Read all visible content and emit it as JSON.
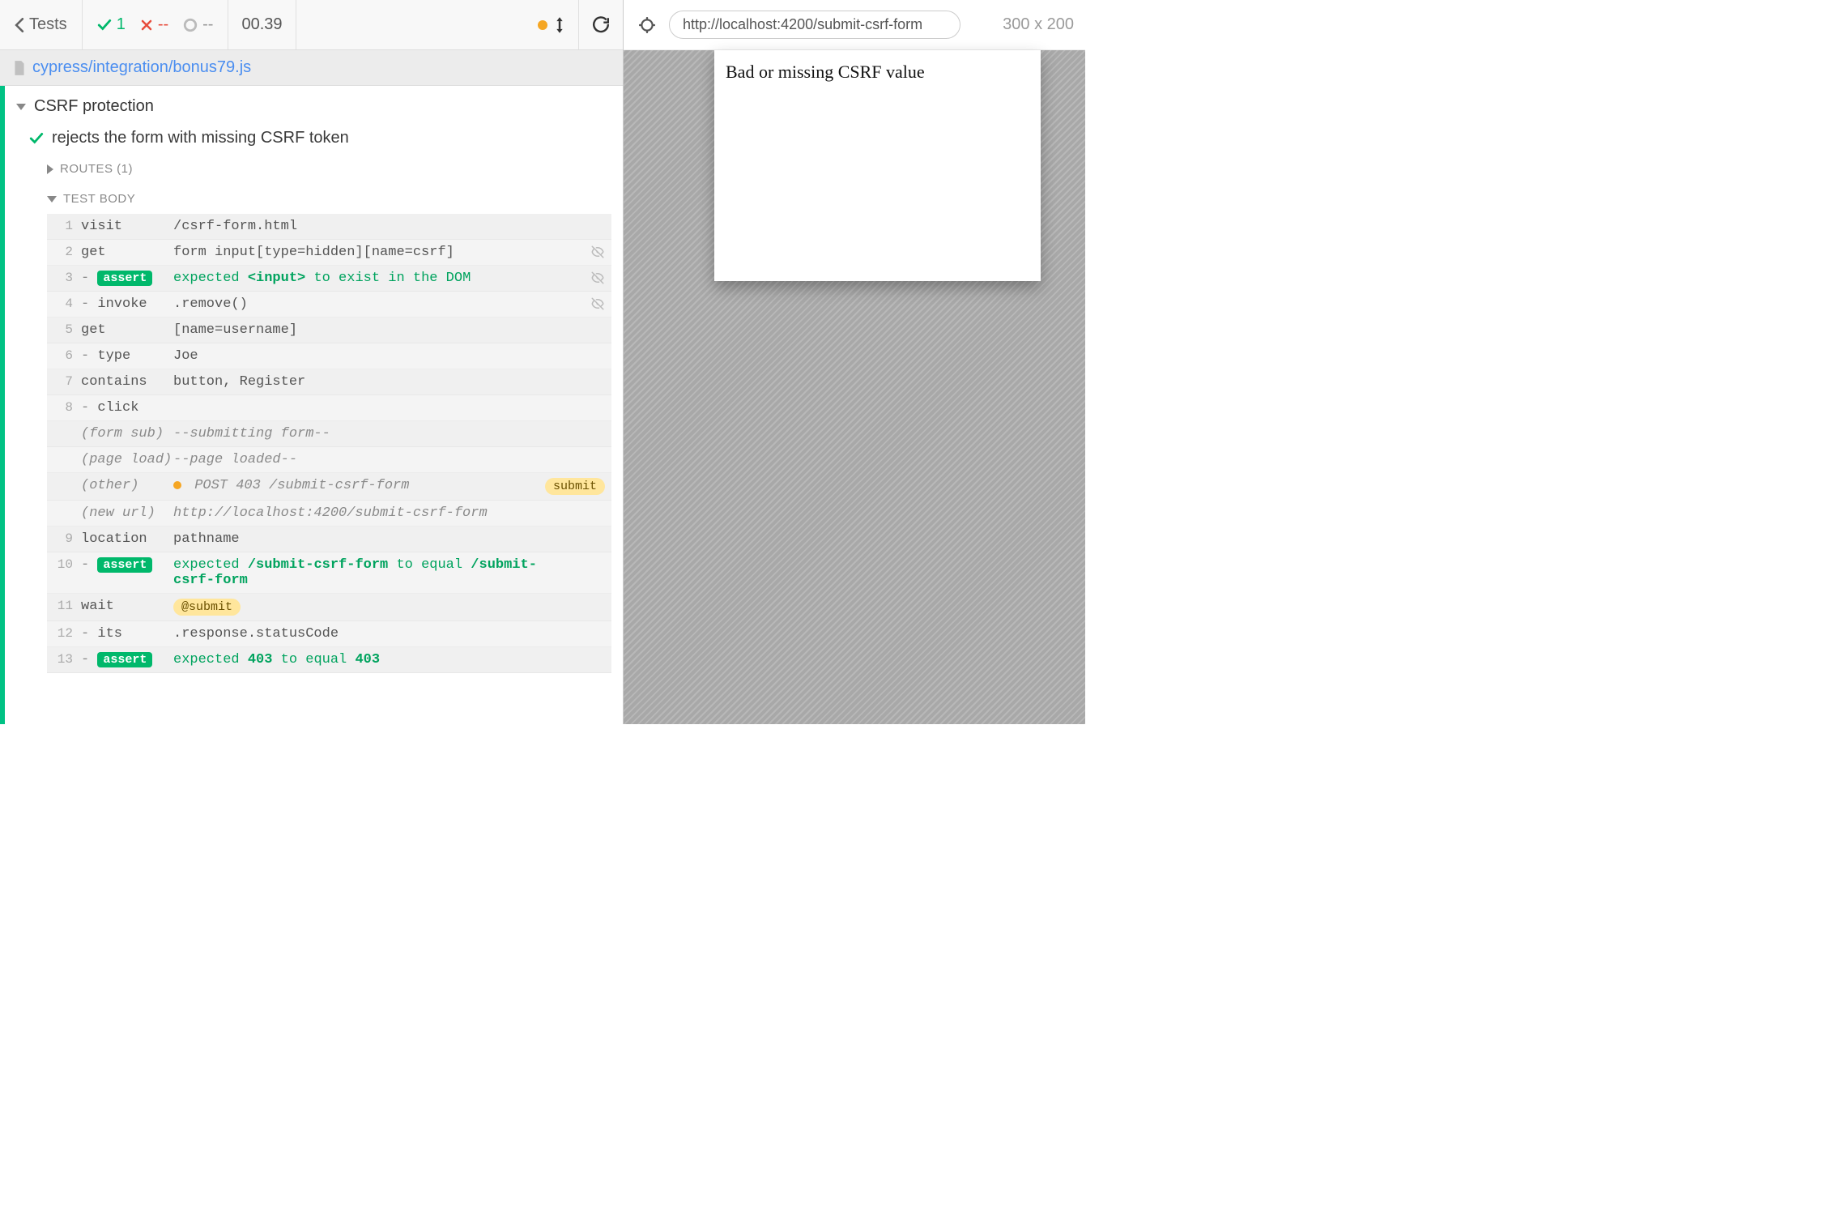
{
  "toolbar": {
    "back_label": "Tests",
    "passed": "1",
    "failed": "--",
    "pending": "--",
    "duration": "00.39"
  },
  "file": {
    "path": "cypress/integration/bonus79.js"
  },
  "suite": {
    "title": "CSRF protection",
    "tests": [
      {
        "status": "pass",
        "title": "rejects the form with missing CSRF token"
      }
    ]
  },
  "sections": {
    "routes_label": "ROUTES (1)",
    "body_label": "TEST BODY"
  },
  "commands": [
    {
      "n": "1",
      "cmd": "visit",
      "child": false,
      "msg_type": "plain",
      "msg": "/csrf-form.html"
    },
    {
      "n": "2",
      "cmd": "get",
      "child": false,
      "msg_type": "plain",
      "msg": "form input[type=hidden][name=csrf]",
      "icon": "eye-off"
    },
    {
      "n": "3",
      "cmd_badge": "assert",
      "child": true,
      "msg_type": "assert",
      "msg_parts": [
        "expected ",
        "<input>",
        " to exist in the DOM"
      ],
      "icon": "eye-off"
    },
    {
      "n": "4",
      "cmd": "invoke",
      "child": true,
      "msg_type": "plain",
      "msg": ".remove()",
      "icon": "eye-off"
    },
    {
      "n": "5",
      "cmd": "get",
      "child": false,
      "msg_type": "plain",
      "msg": "[name=username]"
    },
    {
      "n": "6",
      "cmd": "type",
      "child": true,
      "msg_type": "plain",
      "msg": "Joe"
    },
    {
      "n": "7",
      "cmd": "contains",
      "child": false,
      "msg_type": "plain",
      "msg": "button, Register"
    },
    {
      "n": "8",
      "cmd": "click",
      "child": true,
      "msg_type": "plain",
      "msg": ""
    },
    {
      "event": true,
      "cmd": "(form sub)",
      "msg": "--submitting form--"
    },
    {
      "event": true,
      "cmd": "(page load)",
      "msg": "--page loaded--"
    },
    {
      "event": true,
      "cmd": "(other)",
      "msg_type": "xhr",
      "msg": "POST 403 /submit-csrf-form",
      "alias": "submit"
    },
    {
      "event": true,
      "cmd": "(new url)",
      "msg": "http://localhost:4200/submit-csrf-form"
    },
    {
      "n": "9",
      "cmd": "location",
      "child": false,
      "msg_type": "plain",
      "msg": "pathname"
    },
    {
      "n": "10",
      "cmd_badge": "assert",
      "child": true,
      "msg_type": "assert",
      "msg_parts": [
        "expected ",
        "/submit-csrf-form",
        " to equal ",
        "/submit-csrf-form"
      ]
    },
    {
      "n": "11",
      "cmd": "wait",
      "child": false,
      "msg_type": "alias",
      "msg": "@submit"
    },
    {
      "n": "12",
      "cmd": "its",
      "child": true,
      "msg_type": "plain",
      "msg": ".response.statusCode"
    },
    {
      "n": "13",
      "cmd_badge": "assert",
      "child": true,
      "msg_type": "assert",
      "msg_parts": [
        "expected ",
        "403",
        " to equal ",
        "403"
      ]
    }
  ],
  "preview": {
    "url": "http://localhost:4200/submit-csrf-form",
    "dimensions": "300 x 200",
    "page_text": "Bad or missing CSRF value"
  }
}
